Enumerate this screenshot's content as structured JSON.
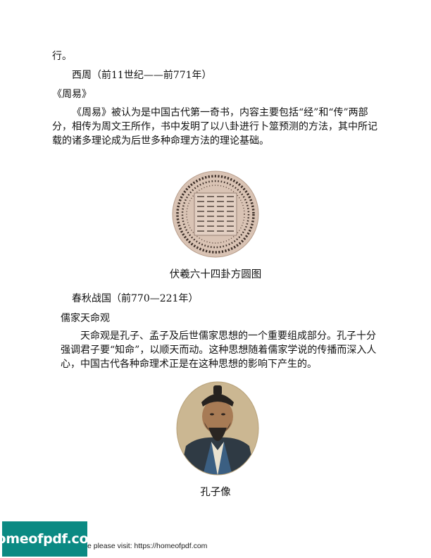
{
  "body": {
    "line_top": "行。",
    "heading_xizhou": "西周（前11世纪——前771年）",
    "title_zhouyi": "《周易》",
    "para_zhouyi": "《周易》被认为是中国古代第一奇书，内容主要包括“经”和“传”两部分，相传为周文王所作，书中发明了以八卦进行卜筮预测的方法，其中所记载的诸多理论成为后世多种命理方法的理论基础。",
    "caption_diagram": "伏羲六十四卦方圆图",
    "heading_chunqiu": "春秋战国（前770—221年）",
    "title_rujia": "儒家天命观",
    "para_tianming": "天命观是孔子、孟子及后世儒家思想的一个重要组成部分。孔子十分强调君子要“知命”，以顺天而动。这种思想随着儒家学说的传播而深入人心，中国古代各种命理术正是在这种思想的影响下产生的。",
    "caption_portrait": "孔子像"
  },
  "footer": {
    "badge_text": "homeofpdf.com",
    "visit_text": "e please visit: https://homeofpdf.com"
  },
  "colors": {
    "badge_bg": "#0b8a83",
    "diagram_bg": "#d9c3b4",
    "text": "#111111"
  }
}
